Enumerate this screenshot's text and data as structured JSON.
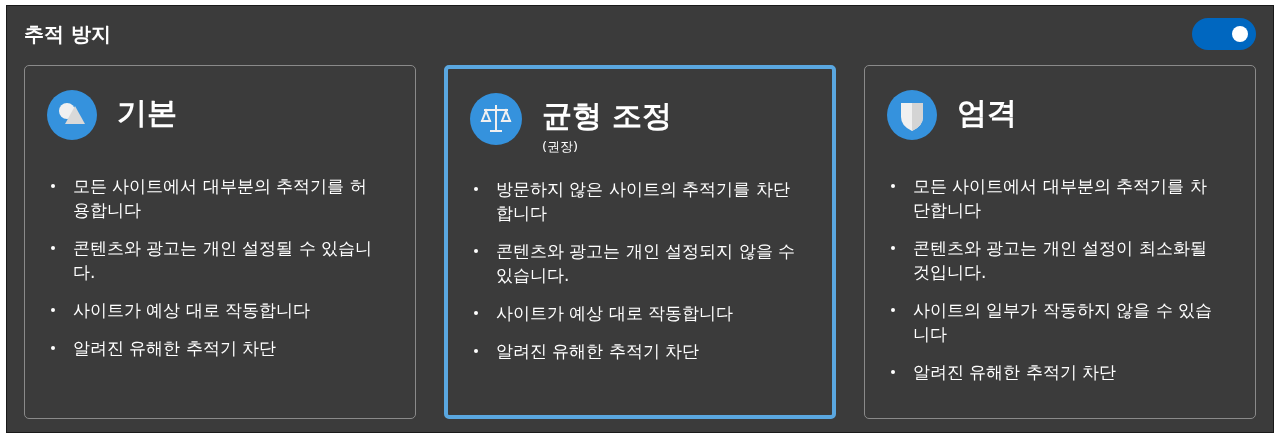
{
  "title": "추적 방지",
  "toggle": {
    "on": true
  },
  "cards": [
    {
      "kind": "shapes",
      "title": "기본",
      "selected": false,
      "bullets": [
        "모든 사이트에서 대부분의 추적기를 허용합니다",
        "콘텐츠와 광고는 개인 설정될 수 있습니다.",
        "사이트가 예상 대로 작동합니다",
        "알려진 유해한 추적기 차단"
      ]
    },
    {
      "kind": "scale",
      "title": "균형 조정",
      "subtitle": "(권장)",
      "selected": true,
      "bullets": [
        "방문하지 않은 사이트의 추적기를 차단합니다",
        "콘텐츠와 광고는 개인 설정되지 않을 수 있습니다.",
        "사이트가 예상 대로 작동합니다",
        "알려진 유해한 추적기 차단"
      ]
    },
    {
      "kind": "shield",
      "title": "엄격",
      "selected": false,
      "bullets": [
        "모든 사이트에서 대부분의 추적기를 차단합니다",
        "콘텐츠와 광고는 개인 설정이 최소화될 것입니다.",
        "사이트의 일부가 작동하지 않을 수 있습니다",
        "알려진 유해한 추적기 차단"
      ]
    }
  ]
}
